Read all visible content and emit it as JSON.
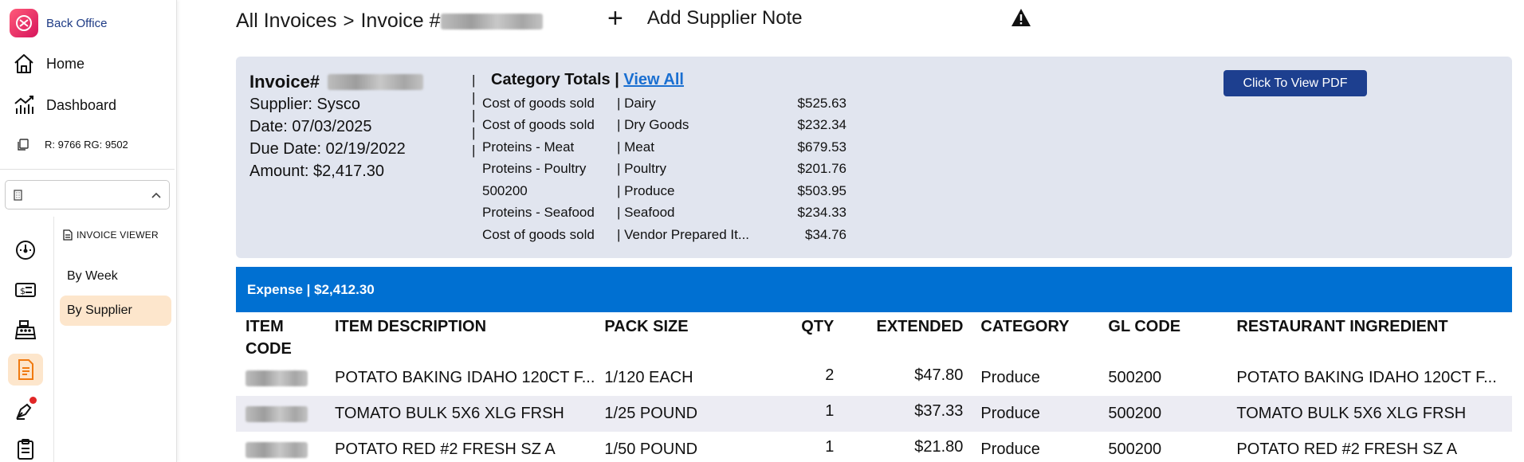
{
  "app": {
    "brand_name": "Back Office",
    "brand_color": "#e0235f"
  },
  "sidebar": {
    "home_label": "Home",
    "dashboard_label": "Dashboard",
    "region_label": "R: 9766 RG: 9502",
    "store_select_value": "",
    "rail_icons": [
      "gauge-icon",
      "ticket-icon",
      "register-icon",
      "invoice-icon",
      "pen-icon",
      "clipboard-icon"
    ],
    "subnav_title": "INVOICE VIEWER",
    "subnav_items": [
      "By Week",
      "By Supplier"
    ],
    "active_subnav": "By Supplier",
    "active_color": "#fde6cc"
  },
  "header": {
    "crumb_root": "All Invoices",
    "crumb_separator": ">",
    "crumb_invoice": "Invoice #",
    "add_note_label": "Add Supplier Note"
  },
  "invoice": {
    "title_label": "Invoice#",
    "supplier": "Supplier: Sysco",
    "date": "Date: 07/03/2025",
    "due_date": "Due Date: 02/19/2022",
    "amount": "Amount: $2,417.30",
    "category_totals_label": "Category Totals |",
    "view_all_label": "View All",
    "pdf_button_label": "Click To View PDF",
    "categories": [
      {
        "account": "Cost of goods sold",
        "category": "| Dairy",
        "amount": "$525.63"
      },
      {
        "account": "Cost of goods sold",
        "category": "| Dry Goods",
        "amount": "$232.34"
      },
      {
        "account": "Proteins - Meat",
        "category": "| Meat",
        "amount": "$679.53"
      },
      {
        "account": "Proteins - Poultry",
        "category": "| Poultry",
        "amount": "$201.76"
      },
      {
        "account": "500200",
        "category": "| Produce",
        "amount": "$503.95"
      },
      {
        "account": "Proteins - Seafood",
        "category": "| Seafood",
        "amount": "$234.33"
      },
      {
        "account": "Cost of goods sold",
        "category": "| Vendor Prepared It...",
        "amount": "$34.76"
      }
    ]
  },
  "expense": {
    "label": "Expense | $2,412.30",
    "color": "#0070d2"
  },
  "table": {
    "headers": {
      "item_code": "ITEM CODE",
      "description": "ITEM DESCRIPTION",
      "pack_size": "PACK SIZE",
      "qty": "QTY",
      "extended": "EXTENDED",
      "category": "CATEGORY",
      "gl_code": "GL CODE",
      "ingredient": "RESTAURANT INGREDIENT"
    },
    "rows": [
      {
        "description": "POTATO BAKING IDAHO 120CT F...",
        "pack_size": "1/120 EACH",
        "qty": "2",
        "extended": "$47.80",
        "category": "Produce",
        "gl_code": "500200",
        "ingredient": "POTATO BAKING IDAHO 120CT F..."
      },
      {
        "description": "TOMATO BULK 5X6 XLG FRSH",
        "pack_size": "1/25 POUND",
        "qty": "1",
        "extended": "$37.33",
        "category": "Produce",
        "gl_code": "500200",
        "ingredient": "TOMATO BULK 5X6 XLG FRSH"
      },
      {
        "description": "POTATO RED #2 FRESH SZ A",
        "pack_size": "1/50 POUND",
        "qty": "1",
        "extended": "$21.80",
        "category": "Produce",
        "gl_code": "500200",
        "ingredient": "POTATO RED #2 FRESH SZ A"
      }
    ]
  }
}
